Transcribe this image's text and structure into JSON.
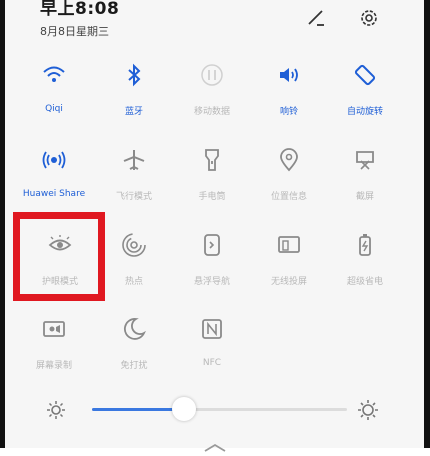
{
  "status": {
    "time": "早上8:08",
    "date": "8月8日星期三"
  },
  "header_icons": [
    "edit-icon",
    "gear-icon"
  ],
  "tiles": [
    {
      "label": "Qiqi",
      "icon": "wifi-icon",
      "state": "on"
    },
    {
      "label": "蓝牙",
      "icon": "bluetooth-icon",
      "state": "on"
    },
    {
      "label": "移动数据",
      "icon": "mobile-data-icon",
      "state": "disabled"
    },
    {
      "label": "响铃",
      "icon": "sound-icon",
      "state": "on"
    },
    {
      "label": "自动旋转",
      "icon": "auto-rotate-icon",
      "state": "on"
    },
    {
      "label": "Huawei Share",
      "icon": "huawei-share-icon",
      "state": "on"
    },
    {
      "label": "飞行模式",
      "icon": "airplane-icon",
      "state": "off"
    },
    {
      "label": "手电筒",
      "icon": "flashlight-icon",
      "state": "off"
    },
    {
      "label": "位置信息",
      "icon": "location-icon",
      "state": "off"
    },
    {
      "label": "截屏",
      "icon": "screenshot-icon",
      "state": "off"
    },
    {
      "label": "护眼模式",
      "icon": "eye-comfort-icon",
      "state": "off"
    },
    {
      "label": "热点",
      "icon": "hotspot-icon",
      "state": "off"
    },
    {
      "label": "悬浮导航",
      "icon": "floating-nav-icon",
      "state": "off"
    },
    {
      "label": "无线投屏",
      "icon": "wireless-projection-icon",
      "state": "off"
    },
    {
      "label": "超级省电",
      "icon": "super-power-saving-icon",
      "state": "off"
    },
    {
      "label": "屏幕录制",
      "icon": "screen-record-icon",
      "state": "off"
    },
    {
      "label": "免打扰",
      "icon": "do-not-disturb-icon",
      "state": "off"
    },
    {
      "label": "NFC",
      "icon": "nfc-icon",
      "state": "off"
    }
  ],
  "brightness": {
    "level": 0.36,
    "icons": [
      "brightness-low-icon",
      "brightness-high-icon"
    ]
  },
  "colors": {
    "accent": "#1f5fd6",
    "highlight_box": "#e01820",
    "inactive_icon": "#8a8a8a"
  }
}
